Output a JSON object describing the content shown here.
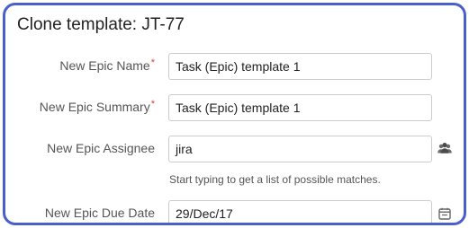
{
  "dialog": {
    "title": "Clone template: JT-77"
  },
  "fields": {
    "epic_name": {
      "label": "New Epic Name",
      "required": "*",
      "value": "Task (Epic) template 1"
    },
    "epic_summary": {
      "label": "New Epic Summary",
      "required": "*",
      "value": "Task (Epic) template 1"
    },
    "epic_assignee": {
      "label": "New Epic Assignee",
      "value": "jira",
      "hint": "Start typing to get a list of possible matches.",
      "icon": "group-users-icon"
    },
    "epic_due_date": {
      "label": "New Epic Due Date",
      "value": "29/Dec/17",
      "icon": "calendar-icon"
    }
  },
  "colors": {
    "frame_border": "#4a5fc9",
    "required_star": "#d04437",
    "label_text": "#555555"
  }
}
